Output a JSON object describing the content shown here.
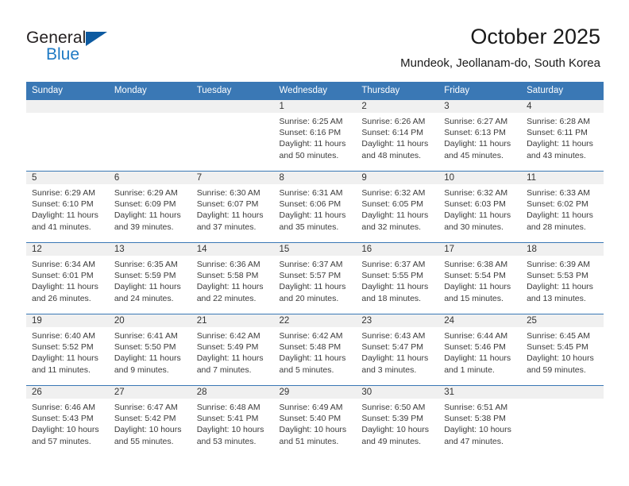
{
  "brand": {
    "name_part1": "General",
    "name_part2": "Blue",
    "flag_icon": "blue-triangle-flag"
  },
  "header": {
    "title": "October 2025",
    "subtitle": "Mundeok, Jeollanam-do, South Korea"
  },
  "colors": {
    "header_bar": "#3a78b5",
    "brand_blue": "#1f7ac4",
    "daynum_band": "#f0f0f0",
    "text": "#3b3b3b"
  },
  "weekday_headers": [
    "Sunday",
    "Monday",
    "Tuesday",
    "Wednesday",
    "Thursday",
    "Friday",
    "Saturday"
  ],
  "labels": {
    "sunrise": "Sunrise:",
    "sunset": "Sunset:",
    "daylight": "Daylight:"
  },
  "weeks": [
    [
      {
        "day": "",
        "empty": true
      },
      {
        "day": "",
        "empty": true
      },
      {
        "day": "",
        "empty": true
      },
      {
        "day": "1",
        "sunrise": "Sunrise: 6:25 AM",
        "sunset": "Sunset: 6:16 PM",
        "daylight": "Daylight: 11 hours and 50 minutes."
      },
      {
        "day": "2",
        "sunrise": "Sunrise: 6:26 AM",
        "sunset": "Sunset: 6:14 PM",
        "daylight": "Daylight: 11 hours and 48 minutes."
      },
      {
        "day": "3",
        "sunrise": "Sunrise: 6:27 AM",
        "sunset": "Sunset: 6:13 PM",
        "daylight": "Daylight: 11 hours and 45 minutes."
      },
      {
        "day": "4",
        "sunrise": "Sunrise: 6:28 AM",
        "sunset": "Sunset: 6:11 PM",
        "daylight": "Daylight: 11 hours and 43 minutes."
      }
    ],
    [
      {
        "day": "5",
        "sunrise": "Sunrise: 6:29 AM",
        "sunset": "Sunset: 6:10 PM",
        "daylight": "Daylight: 11 hours and 41 minutes."
      },
      {
        "day": "6",
        "sunrise": "Sunrise: 6:29 AM",
        "sunset": "Sunset: 6:09 PM",
        "daylight": "Daylight: 11 hours and 39 minutes."
      },
      {
        "day": "7",
        "sunrise": "Sunrise: 6:30 AM",
        "sunset": "Sunset: 6:07 PM",
        "daylight": "Daylight: 11 hours and 37 minutes."
      },
      {
        "day": "8",
        "sunrise": "Sunrise: 6:31 AM",
        "sunset": "Sunset: 6:06 PM",
        "daylight": "Daylight: 11 hours and 35 minutes."
      },
      {
        "day": "9",
        "sunrise": "Sunrise: 6:32 AM",
        "sunset": "Sunset: 6:05 PM",
        "daylight": "Daylight: 11 hours and 32 minutes."
      },
      {
        "day": "10",
        "sunrise": "Sunrise: 6:32 AM",
        "sunset": "Sunset: 6:03 PM",
        "daylight": "Daylight: 11 hours and 30 minutes."
      },
      {
        "day": "11",
        "sunrise": "Sunrise: 6:33 AM",
        "sunset": "Sunset: 6:02 PM",
        "daylight": "Daylight: 11 hours and 28 minutes."
      }
    ],
    [
      {
        "day": "12",
        "sunrise": "Sunrise: 6:34 AM",
        "sunset": "Sunset: 6:01 PM",
        "daylight": "Daylight: 11 hours and 26 minutes."
      },
      {
        "day": "13",
        "sunrise": "Sunrise: 6:35 AM",
        "sunset": "Sunset: 5:59 PM",
        "daylight": "Daylight: 11 hours and 24 minutes."
      },
      {
        "day": "14",
        "sunrise": "Sunrise: 6:36 AM",
        "sunset": "Sunset: 5:58 PM",
        "daylight": "Daylight: 11 hours and 22 minutes."
      },
      {
        "day": "15",
        "sunrise": "Sunrise: 6:37 AM",
        "sunset": "Sunset: 5:57 PM",
        "daylight": "Daylight: 11 hours and 20 minutes."
      },
      {
        "day": "16",
        "sunrise": "Sunrise: 6:37 AM",
        "sunset": "Sunset: 5:55 PM",
        "daylight": "Daylight: 11 hours and 18 minutes."
      },
      {
        "day": "17",
        "sunrise": "Sunrise: 6:38 AM",
        "sunset": "Sunset: 5:54 PM",
        "daylight": "Daylight: 11 hours and 15 minutes."
      },
      {
        "day": "18",
        "sunrise": "Sunrise: 6:39 AM",
        "sunset": "Sunset: 5:53 PM",
        "daylight": "Daylight: 11 hours and 13 minutes."
      }
    ],
    [
      {
        "day": "19",
        "sunrise": "Sunrise: 6:40 AM",
        "sunset": "Sunset: 5:52 PM",
        "daylight": "Daylight: 11 hours and 11 minutes."
      },
      {
        "day": "20",
        "sunrise": "Sunrise: 6:41 AM",
        "sunset": "Sunset: 5:50 PM",
        "daylight": "Daylight: 11 hours and 9 minutes."
      },
      {
        "day": "21",
        "sunrise": "Sunrise: 6:42 AM",
        "sunset": "Sunset: 5:49 PM",
        "daylight": "Daylight: 11 hours and 7 minutes."
      },
      {
        "day": "22",
        "sunrise": "Sunrise: 6:42 AM",
        "sunset": "Sunset: 5:48 PM",
        "daylight": "Daylight: 11 hours and 5 minutes."
      },
      {
        "day": "23",
        "sunrise": "Sunrise: 6:43 AM",
        "sunset": "Sunset: 5:47 PM",
        "daylight": "Daylight: 11 hours and 3 minutes."
      },
      {
        "day": "24",
        "sunrise": "Sunrise: 6:44 AM",
        "sunset": "Sunset: 5:46 PM",
        "daylight": "Daylight: 11 hours and 1 minute."
      },
      {
        "day": "25",
        "sunrise": "Sunrise: 6:45 AM",
        "sunset": "Sunset: 5:45 PM",
        "daylight": "Daylight: 10 hours and 59 minutes."
      }
    ],
    [
      {
        "day": "26",
        "sunrise": "Sunrise: 6:46 AM",
        "sunset": "Sunset: 5:43 PM",
        "daylight": "Daylight: 10 hours and 57 minutes."
      },
      {
        "day": "27",
        "sunrise": "Sunrise: 6:47 AM",
        "sunset": "Sunset: 5:42 PM",
        "daylight": "Daylight: 10 hours and 55 minutes."
      },
      {
        "day": "28",
        "sunrise": "Sunrise: 6:48 AM",
        "sunset": "Sunset: 5:41 PM",
        "daylight": "Daylight: 10 hours and 53 minutes."
      },
      {
        "day": "29",
        "sunrise": "Sunrise: 6:49 AM",
        "sunset": "Sunset: 5:40 PM",
        "daylight": "Daylight: 10 hours and 51 minutes."
      },
      {
        "day": "30",
        "sunrise": "Sunrise: 6:50 AM",
        "sunset": "Sunset: 5:39 PM",
        "daylight": "Daylight: 10 hours and 49 minutes."
      },
      {
        "day": "31",
        "sunrise": "Sunrise: 6:51 AM",
        "sunset": "Sunset: 5:38 PM",
        "daylight": "Daylight: 10 hours and 47 minutes."
      },
      {
        "day": "",
        "empty": true
      }
    ]
  ]
}
